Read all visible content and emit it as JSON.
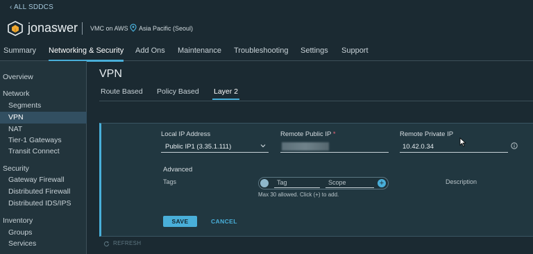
{
  "header": {
    "back_link": "ALL SDDCS",
    "sddc_name": "jonaswer",
    "provider": "VMC on AWS",
    "region": "Asia Pacific (Seoul)"
  },
  "main_tabs": [
    "Summary",
    "Networking & Security",
    "Add Ons",
    "Maintenance",
    "Troubleshooting",
    "Settings",
    "Support"
  ],
  "sidebar": {
    "overview": "Overview",
    "network_heading": "Network",
    "network_items": [
      "Segments",
      "VPN",
      "NAT",
      "Tier-1 Gateways",
      "Transit Connect"
    ],
    "security_heading": "Security",
    "security_items": [
      "Gateway Firewall",
      "Distributed Firewall",
      "Distributed IDS/IPS"
    ],
    "inventory_heading": "Inventory",
    "inventory_items": [
      "Groups",
      "Services"
    ]
  },
  "page": {
    "title": "VPN",
    "subtabs": [
      "Route Based",
      "Policy Based",
      "Layer 2"
    ],
    "active_subtab": "Layer 2"
  },
  "form": {
    "local_ip_label": "Local IP Address",
    "local_ip_value": "Public IP1 (3.35.1.111)",
    "remote_public_ip_label": "Remote Public IP",
    "required_mark": "*",
    "remote_private_ip_label": "Remote Private IP",
    "remote_private_ip_value": "10.42.0.34",
    "advanced_label": "Advanced",
    "tags_label": "Tags",
    "tag_placeholder": "Tag",
    "scope_placeholder": "Scope",
    "add_symbol": "+",
    "tags_hint": "Max 30 allowed. Click (+) to add.",
    "description_label": "Description",
    "save_label": "SAVE",
    "cancel_label": "CANCEL"
  },
  "footer": {
    "refresh_label": "REFRESH"
  },
  "colors": {
    "accent": "#49afd9",
    "background": "#1b2a32",
    "sidebar": "#22343c",
    "card": "#213740",
    "required": "#f4667a"
  }
}
